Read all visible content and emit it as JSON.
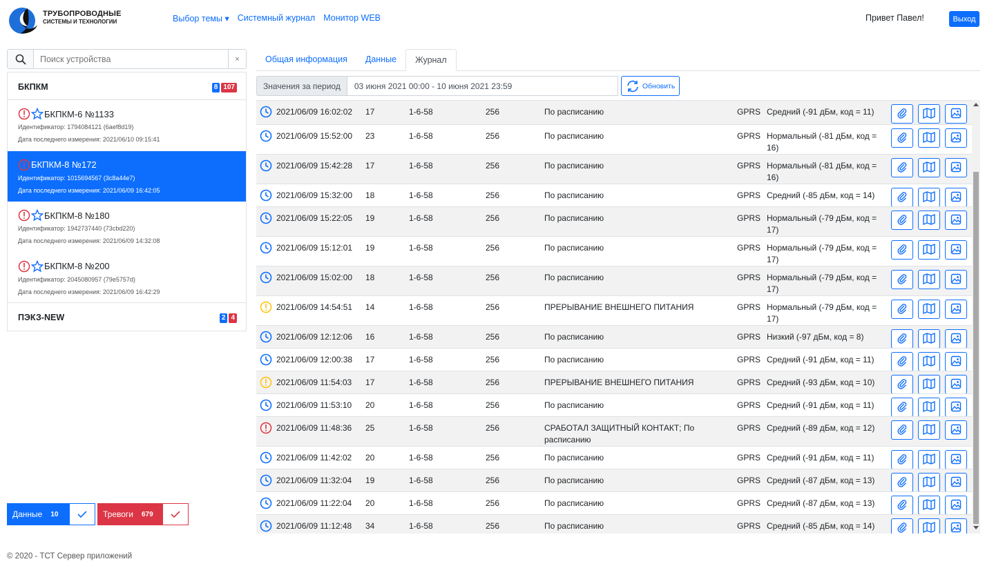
{
  "header": {
    "logo_line1": "ТРУБОПРОВОДНЫЕ",
    "logo_line2": "СИСТЕМЫ И ТЕХНОЛОГИИ",
    "nav": [
      "Выбор темы ▾",
      "Системный журнал",
      "Монитор WEB"
    ],
    "greeting": "Привет Павел!",
    "logout": "Выход"
  },
  "search": {
    "placeholder": "Поиск устройства",
    "clear": "×"
  },
  "devices": {
    "group1": {
      "name": "БКПКМ",
      "badge_blue": "8",
      "badge_red": "107"
    },
    "items": [
      {
        "name": "БКПКМ-6 №1133",
        "id": "Идентификатор: 1794084121 (6aef8d19)",
        "date": "Дата последнего измерения: 2021/06/10 09:15:41"
      },
      {
        "name": "БКПКМ-8 №172",
        "id": "Идентификатор: 1015694567 (3c8a44e7)",
        "date": "Дата последнего измерения: 2021/06/09 16:42:05"
      },
      {
        "name": "БКПКМ-8 №180",
        "id": "Идентификатор: 1942737440 (73cbd220)",
        "date": "Дата последнего измерения: 2021/06/09 14:32:08"
      },
      {
        "name": "БКПКМ-8 №200",
        "id": "Идентификатор: 2045080957 (79e5757d)",
        "date": "Дата последнего измерения: 2021/06/09 16:42:29"
      }
    ],
    "group2": {
      "name": "ПЭКЗ-NEW",
      "badge_blue": "2",
      "badge_red": "4"
    }
  },
  "bottom_buttons": {
    "data_label": "Данные",
    "data_count": "10",
    "alarm_label": "Тревоги",
    "alarm_count": "679"
  },
  "footer": "© 2020 - ТСТ Сервер приложений",
  "tabs": [
    "Общая информация",
    "Данные",
    "Журнал"
  ],
  "period": {
    "label": "Значения за период",
    "value": "03 июня 2021 00:00 - 10 июня 2021 23:59",
    "refresh": "Обновить"
  },
  "colors": {
    "accent": "#0d6efd",
    "danger": "#dc3545",
    "warning": "#ffc107"
  },
  "rows": [
    {
      "icon": "clock",
      "date": "2021/06/09 16:02:02",
      "a": "17",
      "b": "1-6-58",
      "c": "256",
      "event": "По расписанию",
      "net": "GPRS",
      "signal": "Средний (-91 дБм, код = 11)",
      "h": 35
    },
    {
      "icon": "clock",
      "date": "2021/06/09 15:52:00",
      "a": "23",
      "b": "1-6-58",
      "c": "256",
      "event": "По расписанию",
      "net": "GPRS",
      "signal": "Нормальный (-81 дБм, код = 16)",
      "h": 43
    },
    {
      "icon": "clock",
      "date": "2021/06/09 15:42:28",
      "a": "17",
      "b": "1-6-58",
      "c": "256",
      "event": "По расписанию",
      "net": "GPRS",
      "signal": "Нормальный (-81 дБм, код = 16)",
      "h": 43
    },
    {
      "icon": "clock",
      "date": "2021/06/09 15:32:00",
      "a": "18",
      "b": "1-6-58",
      "c": "256",
      "event": "По расписанию",
      "net": "GPRS",
      "signal": "Средний (-85 дБм, код = 14)",
      "h": 33
    },
    {
      "icon": "clock",
      "date": "2021/06/09 15:22:05",
      "a": "19",
      "b": "1-6-58",
      "c": "256",
      "event": "По расписанию",
      "net": "GPRS",
      "signal": "Нормальный (-79 дБм, код = 17)",
      "h": 43
    },
    {
      "icon": "clock",
      "date": "2021/06/09 15:12:01",
      "a": "19",
      "b": "1-6-58",
      "c": "256",
      "event": "По расписанию",
      "net": "GPRS",
      "signal": "Нормальный (-79 дБм, код = 17)",
      "h": 43
    },
    {
      "icon": "clock",
      "date": "2021/06/09 15:02:00",
      "a": "18",
      "b": "1-6-58",
      "c": "256",
      "event": "По расписанию",
      "net": "GPRS",
      "signal": "Нормальный (-79 дБм, код = 17)",
      "h": 43
    },
    {
      "icon": "warn",
      "date": "2021/06/09 14:54:51",
      "a": "14",
      "b": "1-6-58",
      "c": "256",
      "event": "ПРЕРЫВАНИЕ ВНЕШНЕГО ПИТАНИЯ",
      "net": "GPRS",
      "signal": "Нормальный (-79 дБм, код = 17)",
      "h": 43
    },
    {
      "icon": "clock",
      "date": "2021/06/09 12:12:06",
      "a": "16",
      "b": "1-6-58",
      "c": "256",
      "event": "По расписанию",
      "net": "GPRS",
      "signal": "Низкий (-97 дБм, код = 8)",
      "h": 33
    },
    {
      "icon": "clock",
      "date": "2021/06/09 12:00:38",
      "a": "17",
      "b": "1-6-58",
      "c": "256",
      "event": "По расписанию",
      "net": "GPRS",
      "signal": "Средний (-91 дБм, код = 11)",
      "h": 33
    },
    {
      "icon": "warn",
      "date": "2021/06/09 11:54:03",
      "a": "17",
      "b": "1-6-58",
      "c": "256",
      "event": "ПРЕРЫВАНИЕ ВНЕШНЕГО ПИТАНИЯ",
      "net": "GPRS",
      "signal": "Средний (-93 дБм, код = 10)",
      "h": 33
    },
    {
      "icon": "clock",
      "date": "2021/06/09 11:53:10",
      "a": "20",
      "b": "1-6-58",
      "c": "256",
      "event": "По расписанию",
      "net": "GPRS",
      "signal": "Средний (-91 дБм, код = 11)",
      "h": 33
    },
    {
      "icon": "alarm",
      "date": "2021/06/09 11:48:36",
      "a": "25",
      "b": "1-6-58",
      "c": "256",
      "event": "СРАБОТАЛ ЗАЩИТНЫЙ КОНТАКТ; По расписанию",
      "net": "GPRS",
      "signal": "Средний (-89 дБм, код = 12)",
      "h": 43
    },
    {
      "icon": "clock",
      "date": "2021/06/09 11:42:02",
      "a": "20",
      "b": "1-6-58",
      "c": "256",
      "event": "По расписанию",
      "net": "GPRS",
      "signal": "Средний (-91 дБм, код = 11)",
      "h": 33
    },
    {
      "icon": "clock",
      "date": "2021/06/09 11:32:04",
      "a": "19",
      "b": "1-6-58",
      "c": "256",
      "event": "По расписанию",
      "net": "GPRS",
      "signal": "Средний (-87 дБм, код = 13)",
      "h": 33
    },
    {
      "icon": "clock",
      "date": "2021/06/09 11:22:04",
      "a": "20",
      "b": "1-6-58",
      "c": "256",
      "event": "По расписанию",
      "net": "GPRS",
      "signal": "Средний (-87 дБм, код = 13)",
      "h": 33
    },
    {
      "icon": "clock",
      "date": "2021/06/09 11:12:48",
      "a": "34",
      "b": "1-6-58",
      "c": "256",
      "event": "По расписанию",
      "net": "GPRS",
      "signal": "Средний (-85 дБм, код = 14)",
      "h": 33
    }
  ]
}
